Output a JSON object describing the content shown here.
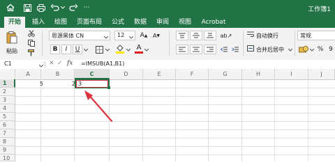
{
  "title_bar": {
    "doc_title": "工作簿1"
  },
  "tabs": [
    "开始",
    "插入",
    "绘图",
    "页面布局",
    "公式",
    "数据",
    "审阅",
    "视图",
    "Acrobat"
  ],
  "active_tab": "开始",
  "ribbon": {
    "paste_label": "粘贴",
    "font_name": "思源黑体 CN",
    "font_size": "12",
    "bold": "B",
    "italic": "I",
    "underline": "U",
    "wrap_text_label": "自动换行",
    "merge_center_label": "合并后居中",
    "number_format": "常规",
    "percent": "%",
    "thousands": "9"
  },
  "formula_bar": {
    "name_box": "C1",
    "fx": "fx",
    "formula": "=IMSUB(A1,B1)"
  },
  "columns": [
    "A",
    "B",
    "C",
    "D",
    "E",
    "F",
    "G",
    "H",
    "I",
    "J"
  ],
  "rows": [
    "1",
    "2",
    "3",
    "4",
    "5",
    "6",
    "7",
    "8",
    "9",
    "10"
  ],
  "cells": {
    "A1": "5",
    "B1": "2",
    "C1": "3"
  },
  "colors": {
    "excel_green": "#217346",
    "annotation_red": "#d9333f"
  }
}
